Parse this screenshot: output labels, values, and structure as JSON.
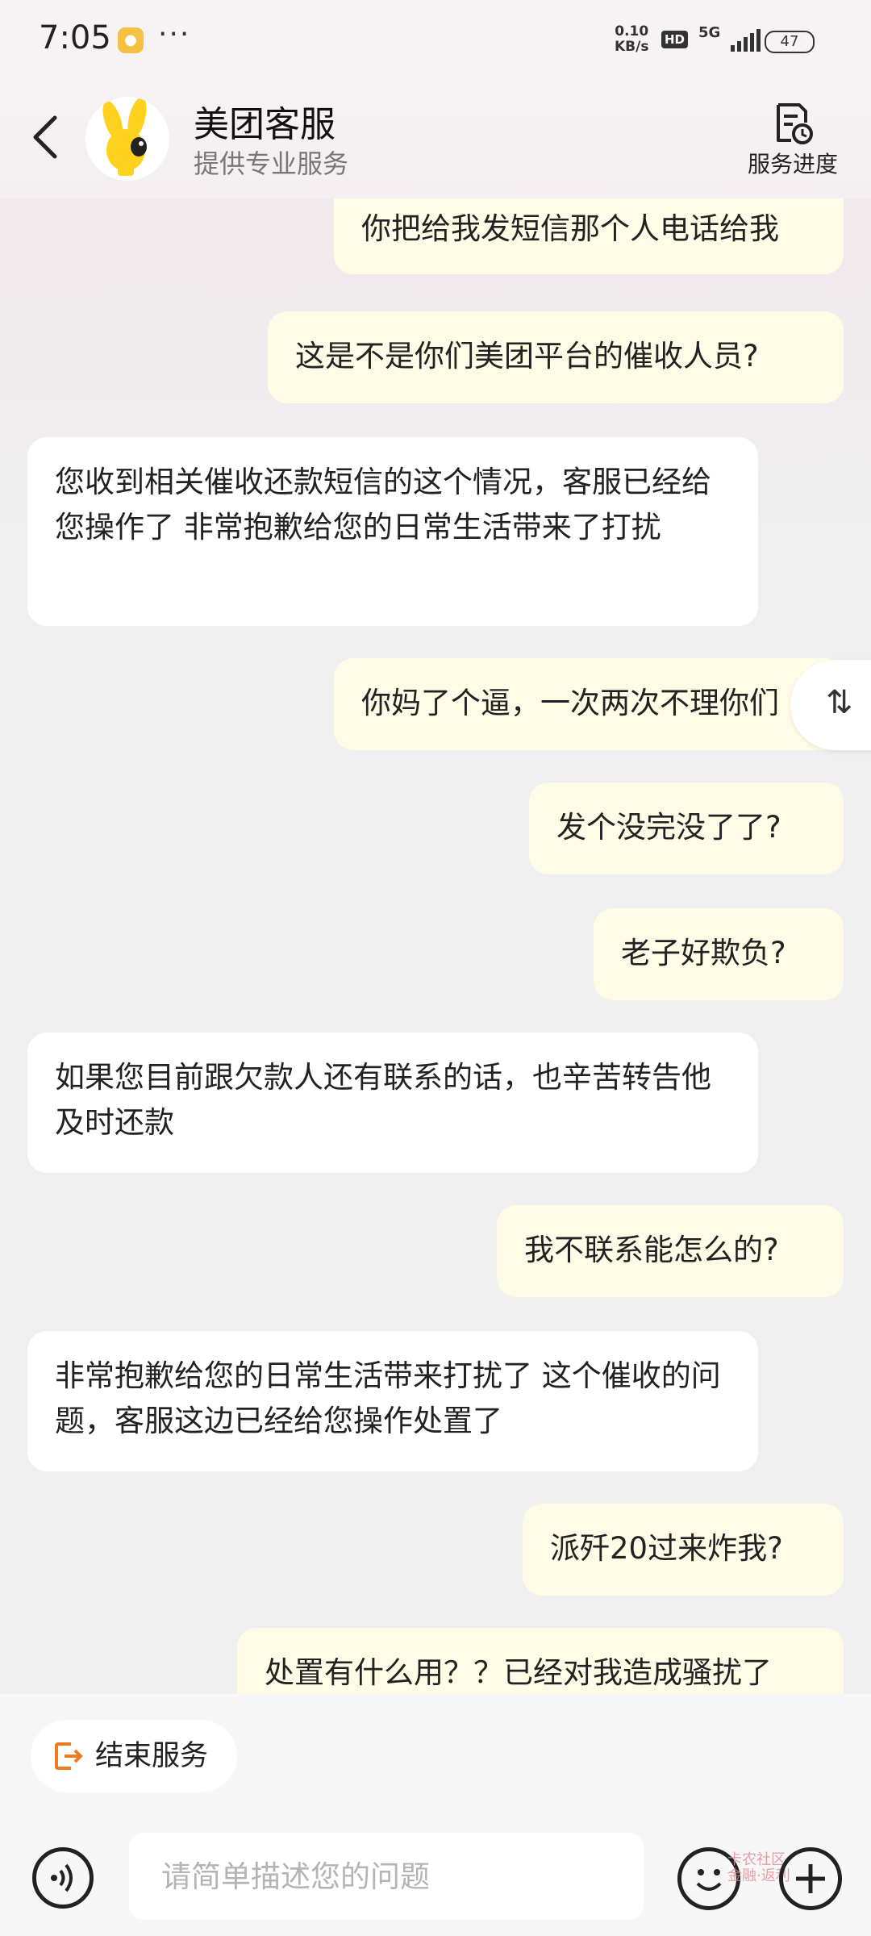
{
  "status_bar": {
    "time": "7:05",
    "speed_value": "0.10",
    "speed_unit": "KB/s",
    "hd": "HD",
    "network": "5G",
    "battery": "47"
  },
  "header": {
    "title": "美团客服",
    "subtitle": "提供专业服务",
    "progress_label": "服务进度"
  },
  "messages": [
    {
      "sender": "me",
      "text": "你把给我发短信那个人电话给我"
    },
    {
      "sender": "me",
      "text": "这是不是你们美团平台的催收人员?"
    },
    {
      "sender": "agent",
      "text": "您收到相关催收还款短信的这个情况，客服已经给您操作了 非常抱歉给您的日常生活带来了打扰"
    },
    {
      "sender": "me",
      "text": "你妈了个逼，一次两次不理你们"
    },
    {
      "sender": "me",
      "text": "发个没完没了了?"
    },
    {
      "sender": "me",
      "text": "老子好欺负?"
    },
    {
      "sender": "agent",
      "text": "如果您目前跟欠款人还有联系的话，也辛苦转告他及时还款"
    },
    {
      "sender": "me",
      "text": "我不联系能怎么的?"
    },
    {
      "sender": "agent",
      "text": "非常抱歉给您的日常生活带来打扰了 这个催收的问题，客服这边已经给您操作处置了"
    },
    {
      "sender": "me",
      "text": "派歼20过来炸我?"
    },
    {
      "sender": "me",
      "text": "处置有什么用？？已经对我造成骚扰了"
    }
  ],
  "side_toggle": {
    "icon": "⇅"
  },
  "bottom": {
    "end_service_label": "结束服务",
    "input_placeholder": "请简单描述您的问题",
    "watermark_title": "卡农社区",
    "watermark_sub": "金融·返利"
  },
  "colors": {
    "user_bubble": "#fefbe7",
    "agent_bubble": "#ffffff",
    "accent_orange": "#f07b1f",
    "mascot_yellow": "#ffd21f"
  }
}
